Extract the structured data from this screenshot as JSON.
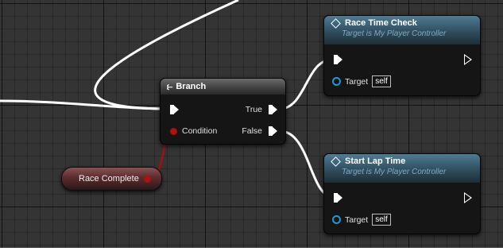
{
  "graph": {
    "branch_node": {
      "title": "Branch",
      "icon": "branch-icon",
      "exec_in_label": "",
      "true_label": "True",
      "false_label": "False",
      "condition_label": "Condition"
    },
    "race_time_check_node": {
      "title": "Race Time Check",
      "subtitle": "Target is My Player Controller",
      "target_label": "Target",
      "target_value": "self"
    },
    "start_lap_time_node": {
      "title": "Start Lap Time",
      "subtitle": "Target is My Player Controller",
      "target_label": "Target",
      "target_value": "self"
    },
    "variable_node": {
      "label": "Race Complete"
    }
  },
  "colors": {
    "canvas": "#343434",
    "exec_wire": "#ffffff",
    "bool_wire": "#a01010",
    "function_header": "#4f7c93",
    "object_pin": "#1a9ad0",
    "bool_pin": "#b01010"
  }
}
